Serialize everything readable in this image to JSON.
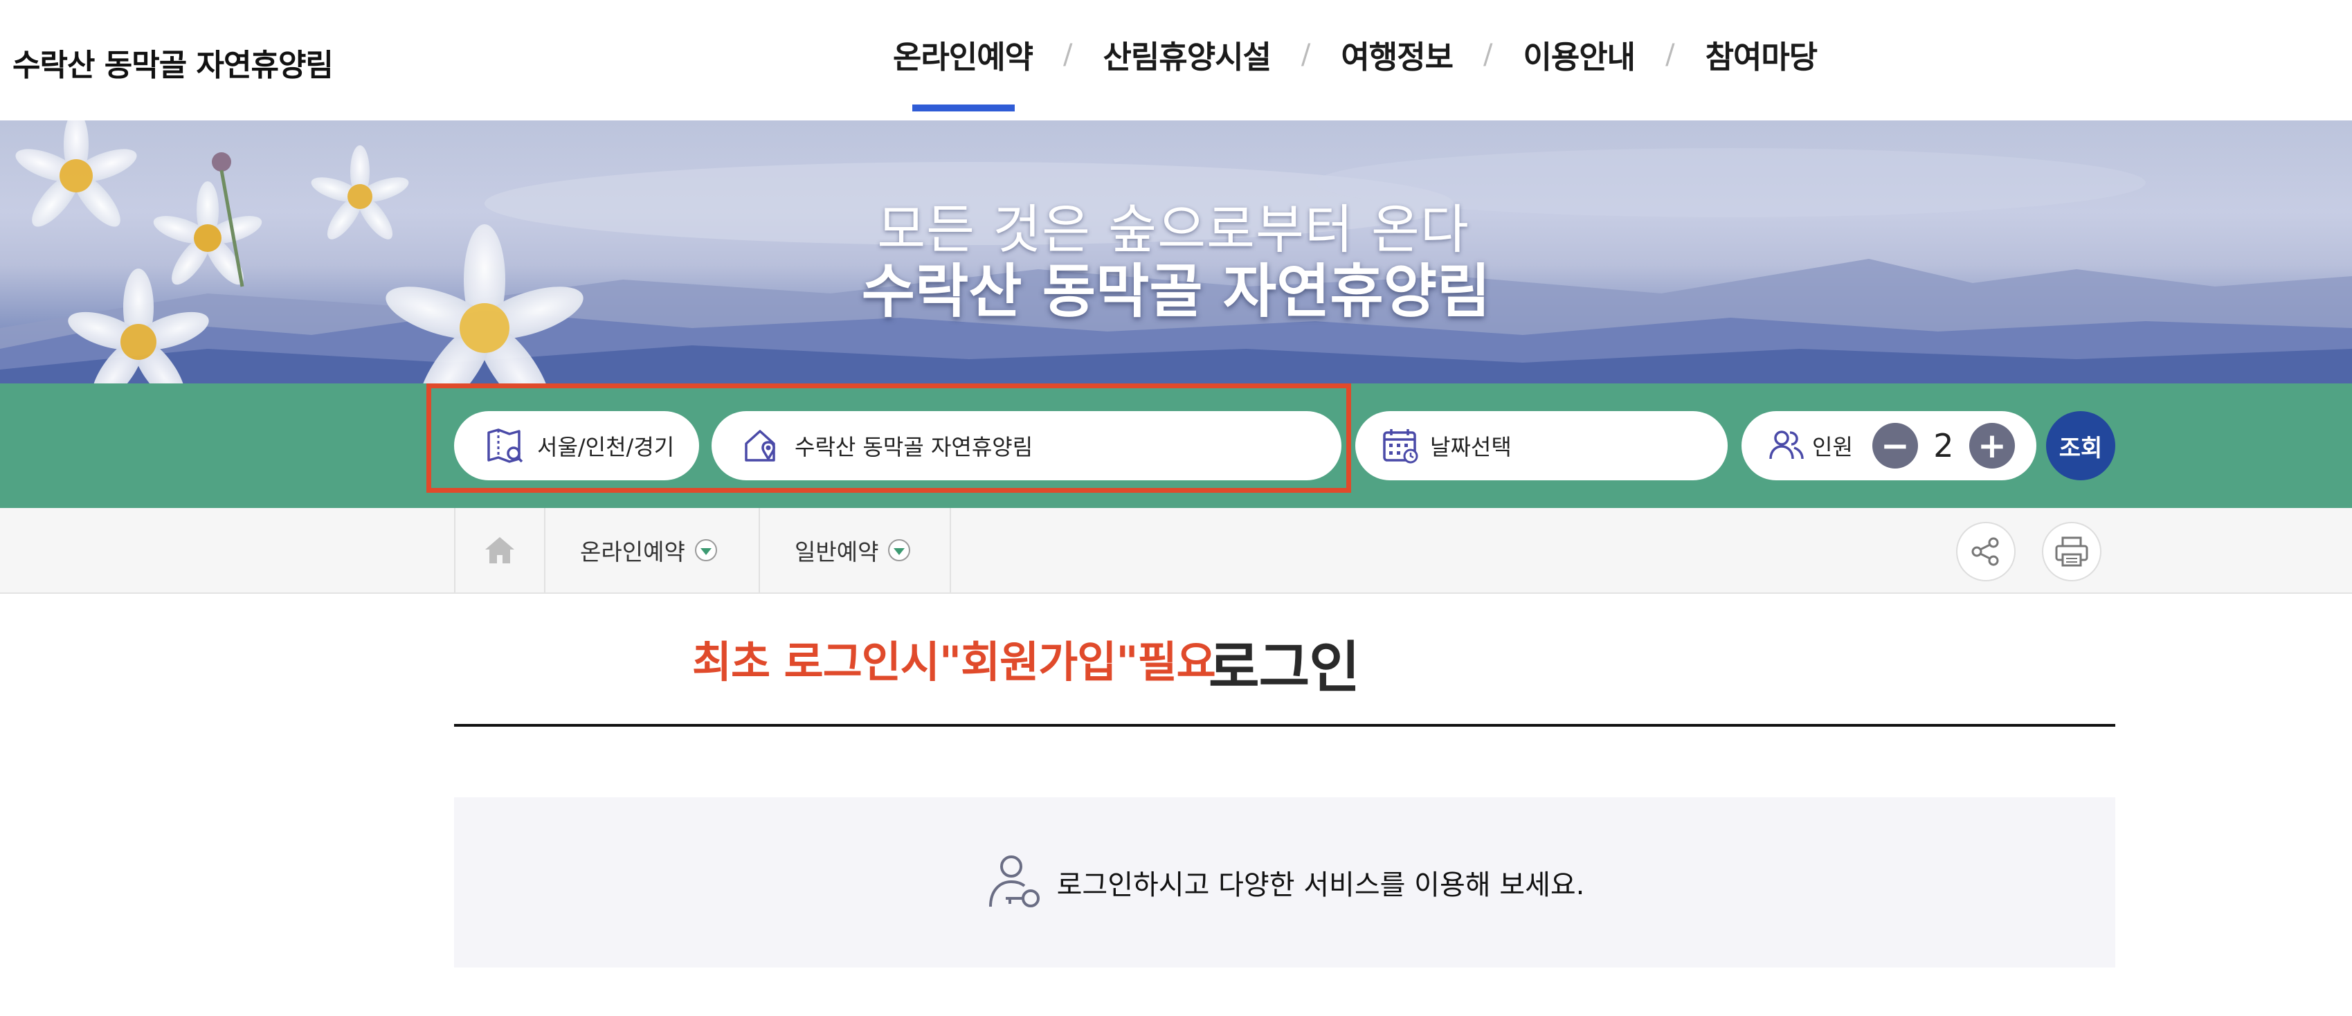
{
  "header": {
    "site_title": "수락산 동막골 자연휴양림",
    "nav": [
      {
        "label": "온라인예약",
        "active": true
      },
      {
        "label": "산림휴양시설"
      },
      {
        "label": "여행정보"
      },
      {
        "label": "이용안내"
      },
      {
        "label": "참여마당"
      }
    ],
    "separator": "/",
    "accent_color": "#2f5cd6"
  },
  "banner": {
    "subtitle": "모든 것은 숲으로부터 온다",
    "title": "수락산 동막골 자연휴양림"
  },
  "search": {
    "region": {
      "label": "서울/인천/경기",
      "icon": "map-icon"
    },
    "facility": {
      "label": "수락산 동막골 자연휴양림",
      "icon": "location-house-icon"
    },
    "date": {
      "label": "날짜선택",
      "icon": "calendar-icon"
    },
    "people": {
      "label": "인원",
      "count": "2",
      "icon": "people-icon",
      "minus": "−",
      "plus": "+"
    },
    "submit_label": "조회",
    "bar_color": "#51a384",
    "highlight_color": "#e04a2b"
  },
  "breadcrumb": {
    "home_icon": "home-icon",
    "items": [
      {
        "label": "온라인예약"
      },
      {
        "label": "일반예약"
      }
    ],
    "share_icon": "share-icon",
    "print_icon": "print-icon"
  },
  "content": {
    "notice": "최초 로그인시\"회원가입\"필요",
    "title": "로그인",
    "login_message": "로그인하시고 다양한 서비스를 이용해 보세요.",
    "login_icon": "user-key-icon"
  }
}
